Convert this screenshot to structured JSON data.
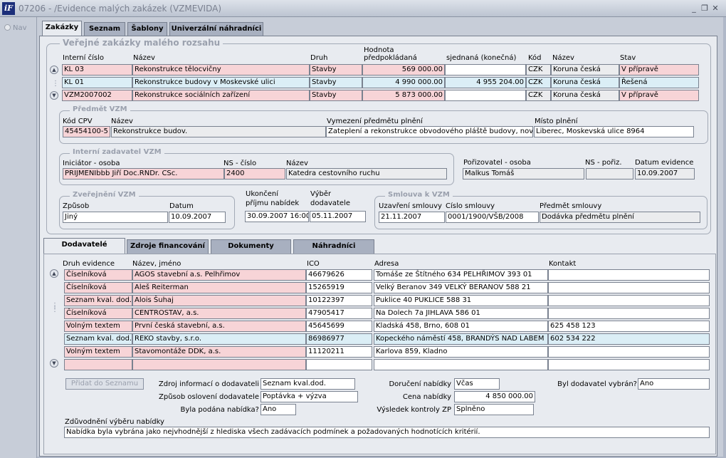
{
  "window": {
    "title": "07206 - /Evidence malých zakázek (VZMEVIDA)",
    "logo": "iF"
  },
  "nav": {
    "label": "Nav"
  },
  "tabs": [
    "Zakázky",
    "Seznam",
    "Šablony",
    "Univerzální náhradníci"
  ],
  "vzm": {
    "title": "Veřejné zakázky malého rozsahu",
    "hdr": {
      "interni_cislo": "Interní číslo",
      "nazev": "Název",
      "druh": "Druh",
      "hodnota": "Hodnota",
      "predpokladana": "předpokládaná",
      "sjednana": "sjednaná (konečná)",
      "kod": "Kód",
      "nazev_meny": "Název",
      "stav": "Stav"
    },
    "rows": [
      {
        "cislo": "KL 03",
        "nazev": "Rekonstrukce tělocvičny",
        "druh": "Stavby",
        "predp": "569 000.00",
        "sjedn": "",
        "kod": "CZK",
        "mena": "Koruna česká",
        "stav": "V přípravě"
      },
      {
        "cislo": "KL 01",
        "nazev": "Rekonstrukce budovy v Moskevské ulici",
        "druh": "Stavby",
        "predp": "4 990 000.00",
        "sjedn": "4 955 204.00",
        "kod": "CZK",
        "mena": "Koruna česká",
        "stav": "Řešená"
      },
      {
        "cislo": "VZM2007002",
        "nazev": "Rekonstrukce sociálních zařízení",
        "druh": "Stavby",
        "predp": "5 873 000.00",
        "sjedn": "",
        "kod": "CZK",
        "mena": "Koruna česká",
        "stav": "V přípravě"
      }
    ]
  },
  "predmet": {
    "title": "Předmět VZM",
    "l_kod": "Kód CPV",
    "l_nazev": "Název",
    "l_vymezeni": "Vymezení předmětu plnění",
    "l_misto": "Místo plnění",
    "kod": "45454100-5",
    "nazev": "Rekonstrukce budov.",
    "vymezeni": "Zateplení a rekonstrukce obvodového pláště budovy, nová",
    "misto": "Liberec, Moskevská ulice 8964"
  },
  "zadavatel": {
    "title": "Interní zadavatel VZM",
    "l_iniciator": "Iniciátor - osoba",
    "l_ns": "NS - číslo",
    "l_nazev": "Název",
    "iniciator": "PRIJMENIbbb Jiří Doc.RNDr. CSc.",
    "ns": "2400",
    "nazev": "Katedra cestovního ruchu"
  },
  "porizovatel": {
    "l_osoba": "Pořizovatel - osoba",
    "l_ns": "NS - pořiz.",
    "l_datum": "Datum evidence",
    "osoba": "Malkus Tomáš",
    "ns": "",
    "datum": "10.09.2007"
  },
  "zverejneni": {
    "title": "Zveřejnění VZM",
    "l_zpusob": "Způsob",
    "l_datum": "Datum",
    "zpusob": "Jiný",
    "datum": "10.09.2007"
  },
  "ukonceni": {
    "l1": "Ukončení",
    "l2": "příjmu nabídek",
    "value": "30.09.2007 16:00"
  },
  "vyber": {
    "l1": "Výběr",
    "l2": "dodavatele",
    "value": "05.11.2007"
  },
  "smlouva": {
    "title": "Smlouva k VZM",
    "l_uzavreni": "Uzavření smlouvy",
    "l_cislo": "Číslo smlouvy",
    "l_predmet": "Předmět smlouvy",
    "uzavreni": "21.11.2007",
    "cislo": "0001/1900/VŠB/2008",
    "predmet": "Dodávka předmětu plnění"
  },
  "subtabs": [
    "Dodavatelé",
    "Zdroje financování",
    "Dokumenty",
    "Náhradníci"
  ],
  "dod": {
    "hdr": {
      "druh": "Druh evidence",
      "nazev": "Název, jméno",
      "ico": "IČO",
      "adresa": "Adresa",
      "kontakt": "Kontakt"
    },
    "rows": [
      {
        "druh": "Číselníková",
        "nazev": "AGOS stavební a.s. Pelhřimov",
        "ico": "46679626",
        "adresa": "Tomáše ze Štítného 634 PELHŘIMOV 393 01",
        "kontakt": ""
      },
      {
        "druh": "Číselníková",
        "nazev": "Aleš Reiterman",
        "ico": "15265919",
        "adresa": "Velký Beranov 349 VELKÝ BERANOV 588 21",
        "kontakt": ""
      },
      {
        "druh": "Seznam kval. dod.",
        "nazev": "Alois Šuhaj",
        "ico": "10122397",
        "adresa": "Puklice 40 PUKLICE 588 31",
        "kontakt": ""
      },
      {
        "druh": "Číselníková",
        "nazev": "CENTROSTAV, a.s.",
        "ico": "47905417",
        "adresa": "Na Dolech 7a JIHLAVA 586 01",
        "kontakt": ""
      },
      {
        "druh": "Volným textem",
        "nazev": "První česká stavební, a.s.",
        "ico": "45645699",
        "adresa": "Kladská 458, Brno, 608 01",
        "kontakt": "625 458 123"
      },
      {
        "druh": "Seznam kval. dod.",
        "nazev": "REKO stavby, s.r.o.",
        "ico": "86986977",
        "adresa": "Kopeckého náměstí 458, BRANDÝS NAD LABEM",
        "kontakt": "602 534 222"
      },
      {
        "druh": "Volným textem",
        "nazev": "Stavomontáže DDK, a.s.",
        "ico": "11120211",
        "adresa": "Karlova 859, Kladno",
        "kontakt": ""
      },
      {
        "druh": "",
        "nazev": "",
        "ico": "",
        "adresa": "",
        "kontakt": ""
      }
    ]
  },
  "detail": {
    "add_button": "Přidat do Seznamu",
    "l_zdroj": "Zdroj informací o dodavateli",
    "zdroj": "Seznam kval.dod.",
    "l_zpusob": "Způsob oslovení dodavatele",
    "zpusob": "Poptávka + výzva",
    "l_podana": "Byla podána nabídka?",
    "podana": "Ano",
    "l_doruceni": "Doručení nabídky",
    "doruceni": "Včas",
    "l_cena": "Cena nabídky",
    "cena": "4 850 000.00",
    "l_vysledek": "Výsledek kontroly ZP",
    "vysledek": "Splněno",
    "l_vybran": "Byl dodavatel vybrán?",
    "vybran": "Ano",
    "l_zduvodneni": "Zdůvodnění výběru nabídky",
    "zduvodneni": "Nabídka byla vybrána jako nejvhodnější z hlediska všech zadávacích podmínek a požadovaných hodnotících kritérií."
  }
}
